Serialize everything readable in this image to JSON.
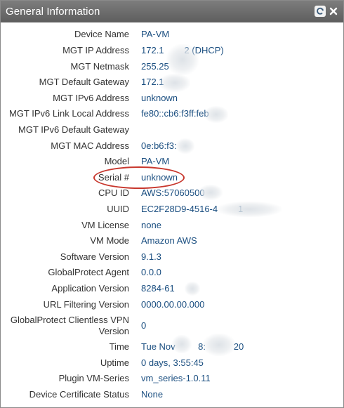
{
  "panel": {
    "title": "General Information",
    "refresh_icon": "refresh-icon",
    "close_icon": "close-icon"
  },
  "rows": [
    {
      "label": "Device Name",
      "value": "PA-VM"
    },
    {
      "label": "MGT IP Address",
      "value": "172.1        2 (DHCP)"
    },
    {
      "label": "MGT Netmask",
      "value": "255.25"
    },
    {
      "label": "MGT Default Gateway",
      "value": "172.1"
    },
    {
      "label": "MGT IPv6 Address",
      "value": "unknown"
    },
    {
      "label": "MGT IPv6 Link Local Address",
      "value": "fe80::cb6:f3ff:feb"
    },
    {
      "label": "MGT IPv6 Default Gateway",
      "value": ""
    },
    {
      "label": "MGT MAC Address",
      "value": "0e:b6:f3:"
    },
    {
      "label": "Model",
      "value": "PA-VM"
    },
    {
      "label": "Serial #",
      "value": "unknown"
    },
    {
      "label": "CPU ID",
      "value": "AWS:57060500"
    },
    {
      "label": "UUID",
      "value": "EC2F28D9-4516-4        1"
    },
    {
      "label": "VM License",
      "value": "none"
    },
    {
      "label": "VM Mode",
      "value": "Amazon AWS"
    },
    {
      "label": "Software Version",
      "value": "9.1.3"
    },
    {
      "label": "GlobalProtect Agent",
      "value": "0.0.0"
    },
    {
      "label": "Application Version",
      "value": "8284-61"
    },
    {
      "label": "URL Filtering Version",
      "value": "0000.00.00.000"
    },
    {
      "label": "GlobalProtect Clientless VPN Version",
      "value": "0"
    },
    {
      "label": "Time",
      "value": "Tue Nov         8:           20"
    },
    {
      "label": "Uptime",
      "value": "0 days, 3:55:45"
    },
    {
      "label": "Plugin VM-Series",
      "value": "vm_series-1.0.11"
    },
    {
      "label": "Device Certificate Status",
      "value": "None"
    }
  ],
  "highlight": {
    "color": "#c8372d"
  },
  "colors": {
    "value_text": "#1a4e80",
    "label_text": "#333333",
    "titlebar": "#6b6b6b"
  }
}
